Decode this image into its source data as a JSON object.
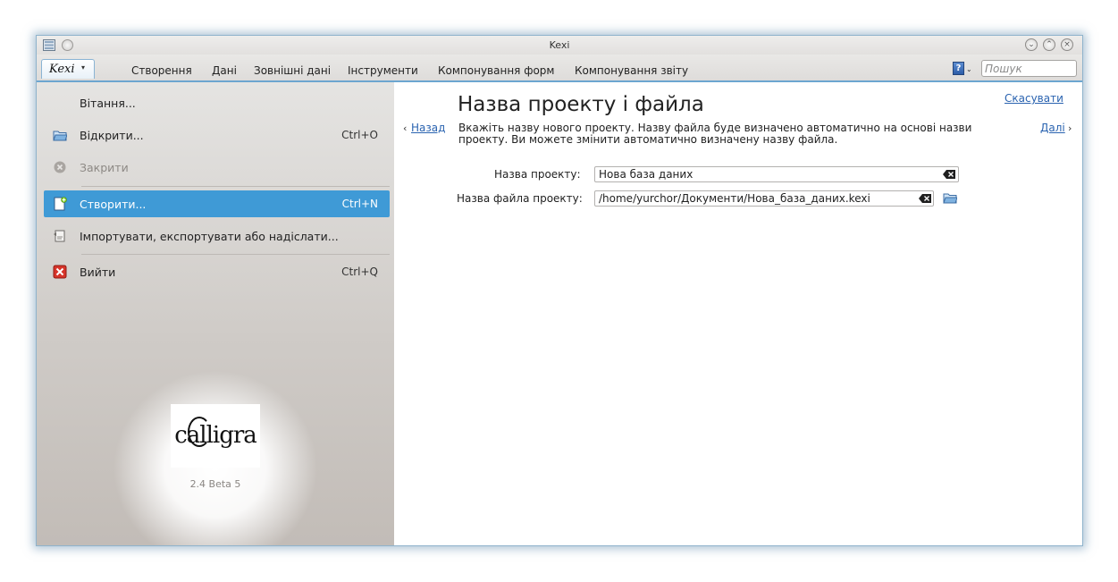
{
  "window": {
    "title": "Kexi"
  },
  "menubar": {
    "app_button": "Kexi",
    "tabs": [
      "Створення",
      "Дані",
      "Зовнішні дані",
      "Інструменти",
      "Компонування форм",
      "Компонування звіту"
    ],
    "search_placeholder": "Пошук"
  },
  "menu": {
    "items": [
      {
        "label": "Вітання...",
        "shortcut": "",
        "icon": "none",
        "state": "normal"
      },
      {
        "label": "Відкрити...",
        "shortcut": "Ctrl+O",
        "icon": "open-folder-icon",
        "state": "normal"
      },
      {
        "label": "Закрити",
        "shortcut": "",
        "icon": "close-circle-icon",
        "state": "disabled"
      },
      {
        "label": "Створити...",
        "shortcut": "Ctrl+N",
        "icon": "new-document-icon",
        "state": "selected"
      },
      {
        "label": "Імпортувати, експортувати або надіслати...",
        "shortcut": "",
        "icon": "import-export-icon",
        "state": "normal"
      },
      {
        "label": "Вийти",
        "shortcut": "Ctrl+Q",
        "icon": "exit-icon",
        "state": "normal"
      }
    ]
  },
  "branding": {
    "logo_text": "calligra",
    "version": "2.4 Beta 5"
  },
  "wizard": {
    "title": "Назва проекту і файла",
    "cancel": "Скасувати",
    "back": "Назад",
    "next": "Далі",
    "description": "Вкажіть назву нового проекту. Назву файла буде визначено автоматично на основі назви проекту. Ви можете змінити автоматично визначену назву файла.",
    "project_name_label": "Назва проекту:",
    "project_name_value": "Нова база даних",
    "file_name_label": "Назва файла проекту:",
    "file_name_value": "/home/yurchor/Документи/Нова_база_даних.kexi"
  },
  "colors": {
    "accent": "#3f9ad6",
    "link": "#2a63b0",
    "menu_panel": "#d3cfcb"
  }
}
